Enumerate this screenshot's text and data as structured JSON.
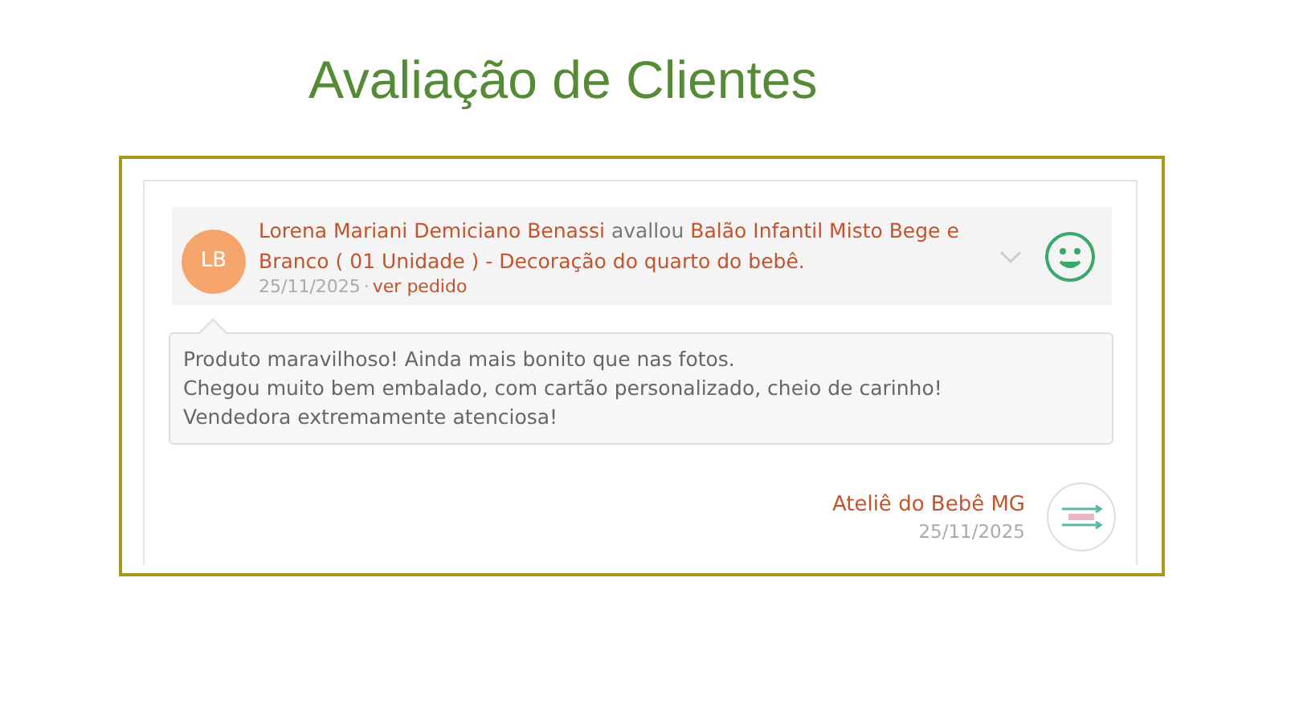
{
  "title": "Avaliação de Clientes",
  "review": {
    "initials": "LB",
    "reviewer": "Lorena Mariani Demiciano Benassi",
    "verb": "avallou",
    "product": "Balão Infantil Misto Bege e Branco ( 01 Unidade ) - Decoração do quarto do bebê.",
    "date": "25/11/2025",
    "separator": "·",
    "link": "ver pedido",
    "expanded": false,
    "positive": true,
    "comment": "Produto maravilhoso! Ainda mais bonito que nas fotos.\nChegou muito bem embalado, com cartão personalizado, cheio de carinho!\nVendedora extremamente atenciosa!"
  },
  "reply": {
    "seller": "Ateliê do Bebê MG",
    "date": "25/11/2025"
  }
}
